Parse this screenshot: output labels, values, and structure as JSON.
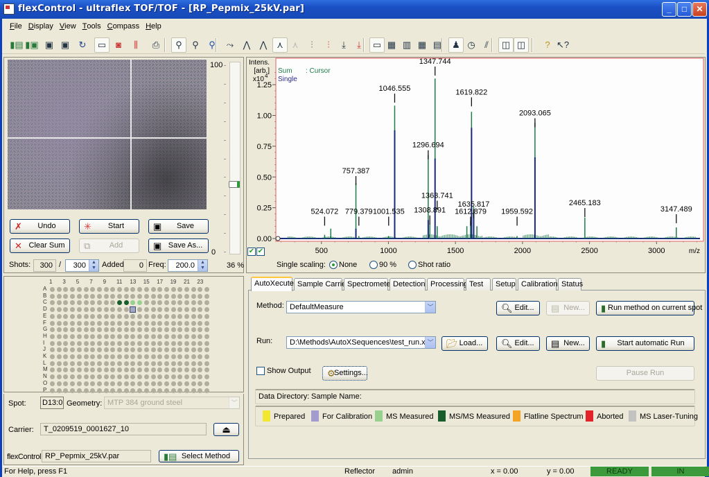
{
  "window": {
    "title": "flexControl - ultraflex TOF/TOF - [RP_Pepmix_25kV.par]",
    "controls": {
      "minimize": "_",
      "maximize": "□",
      "close": "✕"
    }
  },
  "menu": [
    {
      "label": "File",
      "ul": "F",
      "rest": "ile"
    },
    {
      "label": "Display",
      "ul": "D",
      "rest": "isplay"
    },
    {
      "label": "View",
      "ul": "V",
      "rest": "iew"
    },
    {
      "label": "Tools",
      "ul": "T",
      "rest": "ools"
    },
    {
      "label": "Compass",
      "ul": "C",
      "rest": "ompass"
    },
    {
      "label": "Help",
      "ul": "H",
      "rest": "elp"
    }
  ],
  "toolbar": {
    "icons": [
      {
        "name": "open-method-icon",
        "glyph": "▮▤"
      },
      {
        "name": "save-method-icon",
        "glyph": "▮▣"
      },
      {
        "name": "save-icon",
        "glyph": "▣"
      },
      {
        "name": "save-as-icon",
        "glyph": "▣"
      },
      {
        "name": "refresh-icon",
        "glyph": "↻"
      },
      {
        "name": "camera-icon",
        "glyph": "▭"
      },
      {
        "name": "camera-record-icon",
        "glyph": "◙"
      },
      {
        "name": "peak-icon",
        "glyph": "⫼"
      },
      {
        "name": "print-icon",
        "glyph": "⎙"
      },
      {
        "name": "zoom-icon",
        "glyph": "⚲"
      },
      {
        "name": "zoom-x-icon",
        "glyph": "⚲"
      },
      {
        "name": "zoom-reset-icon",
        "glyph": "⚲"
      },
      {
        "name": "peak-pick-icon",
        "glyph": "⤳"
      },
      {
        "name": "peak-add-icon",
        "glyph": "⋀"
      },
      {
        "name": "peak-remove-icon",
        "glyph": "⋀"
      },
      {
        "name": "spectrum-label-icon",
        "glyph": "⋏"
      },
      {
        "name": "spectrum-label-disabled-icon",
        "glyph": "⋏"
      },
      {
        "name": "sum-spectra-icon",
        "glyph": "⫶"
      },
      {
        "name": "sum-spectra-red-icon",
        "glyph": "⫶"
      },
      {
        "name": "peak-down-icon",
        "glyph": "⤓"
      },
      {
        "name": "peak-down-sum-icon",
        "glyph": "⤓"
      },
      {
        "name": "layout-1-icon",
        "glyph": "▭"
      },
      {
        "name": "layout-2-icon",
        "glyph": "▦"
      },
      {
        "name": "layout-3-icon",
        "glyph": "▥"
      },
      {
        "name": "layout-4-icon",
        "glyph": "▦"
      },
      {
        "name": "layout-5-icon",
        "glyph": "▤"
      },
      {
        "name": "user-icon",
        "glyph": "♟"
      },
      {
        "name": "clock-icon",
        "glyph": "◷"
      },
      {
        "name": "calibrate-icon",
        "glyph": "⫽"
      },
      {
        "name": "spectrum-view-icon",
        "glyph": "◫"
      },
      {
        "name": "events-view-icon",
        "glyph": "◫"
      },
      {
        "name": "help-icon",
        "glyph": "?"
      },
      {
        "name": "context-help-icon",
        "glyph": "↖?"
      }
    ]
  },
  "camera": {
    "slider": {
      "max_label": "100",
      "min_label": "0",
      "value_percent": 36,
      "value_label": "36 %"
    }
  },
  "acquisition": {
    "undo": "Undo",
    "start": "Start",
    "save": "Save",
    "clear_sum": "Clear Sum",
    "add": "Add",
    "save_as": "Save As...",
    "shots_label": "Shots:",
    "shots_value": "300",
    "shots_sep": "/",
    "shots_total": "300",
    "added_label": "Added:",
    "added_value": "0",
    "freq_label": "Freq:",
    "freq_value": "200.0"
  },
  "plate": {
    "columns_labeled": [
      "1",
      "3",
      "5",
      "7",
      "9",
      "11",
      "13",
      "15",
      "17",
      "19",
      "21",
      "23"
    ],
    "rows": [
      "A",
      "B",
      "C",
      "D",
      "E",
      "F",
      "G",
      "H",
      "I",
      "J",
      "K",
      "L",
      "M",
      "N",
      "O",
      "P"
    ],
    "num_columns": 24,
    "special_wells": [
      {
        "row": "C",
        "col": 11,
        "state": "MS/MS Measured"
      },
      {
        "row": "C",
        "col": 12,
        "state": "MS/MS Measured"
      },
      {
        "row": "C",
        "col": 13,
        "state": "MS Measured"
      },
      {
        "row": "C",
        "col": 14,
        "state": "MS Measured"
      },
      {
        "row": "D",
        "col": 13,
        "state": "current"
      }
    ]
  },
  "spot_info": {
    "spot_label": "Spot:",
    "spot_value": "D13:0",
    "geometry_label": "Geometry:",
    "geometry_value": "MTP 384 ground steel",
    "carrier_label": "Carrier:",
    "carrier_value": "T_0209519_0001627_10",
    "eject_glyph": "⏏",
    "flexcontrol_label": "flexControl:",
    "flexcontrol_value": "RP_Pepmix_25kV.par",
    "select_method": "Select Method"
  },
  "chart_data": {
    "type": "line",
    "title": "",
    "ylabel": "Intens. [arb.] x10^4",
    "ylabel_lines": [
      "Intens.",
      "[arb.]",
      "x10"
    ],
    "ylabel_exp": "4",
    "xlabel": "m/z",
    "legend": {
      "sum": "Sum",
      "cursor": ": Cursor",
      "single": "Single",
      "placement": "top-left"
    },
    "xlim": [
      160,
      3350
    ],
    "ylim": [
      0,
      1.42
    ],
    "xticks": [
      500,
      1000,
      1500,
      2000,
      2500,
      3000
    ],
    "xtick_labels": [
      "500",
      "1000",
      "1500",
      "2000",
      "2500",
      "3000"
    ],
    "yticks": [
      0.0,
      0.25,
      0.5,
      0.75,
      1.0,
      1.25
    ],
    "ytick_labels": [
      "0.00",
      "0.25",
      "0.50",
      "0.75",
      "1.00",
      "1.25"
    ],
    "series": [
      {
        "name": "Sum",
        "color": "#1e7b4a",
        "peaks": [
          {
            "mz": 524.072,
            "intensity": 0.03
          },
          {
            "mz": 570,
            "intensity": 0.08
          },
          {
            "mz": 757.387,
            "intensity": 0.45
          },
          {
            "mz": 779.379,
            "intensity": 0.02
          },
          {
            "mz": 1001.535,
            "intensity": 0.02
          },
          {
            "mz": 1046.555,
            "intensity": 1.08
          },
          {
            "mz": 1296.694,
            "intensity": 0.68
          },
          {
            "mz": 1308.891,
            "intensity": 0.12
          },
          {
            "mz": 1347.744,
            "intensity": 1.3
          },
          {
            "mz": 1363.741,
            "intensity": 0.1
          },
          {
            "mz": 1585,
            "intensity": 0.1
          },
          {
            "mz": 1612.879,
            "intensity": 0.14
          },
          {
            "mz": 1619.822,
            "intensity": 1.03
          },
          {
            "mz": 1635.817,
            "intensity": 0.26
          },
          {
            "mz": 1660,
            "intensity": 0.1
          },
          {
            "mz": 1959.592,
            "intensity": 0.02
          },
          {
            "mz": 2093.065,
            "intensity": 0.94
          },
          {
            "mz": 2465.183,
            "intensity": 0.17
          },
          {
            "mz": 3147.489,
            "intensity": 0.09
          }
        ]
      },
      {
        "name": "Single",
        "color": "#1a2a7a",
        "peaks": [
          {
            "mz": 757.387,
            "intensity": 0.08
          },
          {
            "mz": 1046.555,
            "intensity": 0.88
          },
          {
            "mz": 1296.694,
            "intensity": 0.15
          },
          {
            "mz": 1347.744,
            "intensity": 0.65
          },
          {
            "mz": 1619.822,
            "intensity": 0.9
          },
          {
            "mz": 1635.817,
            "intensity": 0.2
          },
          {
            "mz": 2093.065,
            "intensity": 0.66
          }
        ]
      }
    ],
    "peak_labels": [
      {
        "text": "524.072",
        "mz": 524.072,
        "y": 0.2
      },
      {
        "text": "757.387",
        "mz": 757.387,
        "y": 0.53
      },
      {
        "text": "779.379",
        "mz": 779.379,
        "y": 0.2
      },
      {
        "text": "1001.535",
        "mz": 1001.535,
        "y": 0.2
      },
      {
        "text": "1046.555",
        "mz": 1046.555,
        "y": 1.2
      },
      {
        "text": "1296.694",
        "mz": 1296.694,
        "y": 0.74
      },
      {
        "text": "1308.891",
        "mz": 1308.891,
        "y": 0.21
      },
      {
        "text": "1347.744",
        "mz": 1347.744,
        "y": 1.42
      },
      {
        "text": "1363.741",
        "mz": 1363.741,
        "y": 0.33
      },
      {
        "text": "1612.879",
        "mz": 1612.879,
        "y": 0.2
      },
      {
        "text": "1619.822",
        "mz": 1619.822,
        "y": 1.17
      },
      {
        "text": "1635.817",
        "mz": 1635.817,
        "y": 0.26
      },
      {
        "text": "1959.592",
        "mz": 1959.592,
        "y": 0.2
      },
      {
        "text": "2093.065",
        "mz": 2093.065,
        "y": 1.0
      },
      {
        "text": "2465.183",
        "mz": 2465.183,
        "y": 0.27
      },
      {
        "text": "3147.489",
        "mz": 3147.489,
        "y": 0.22
      }
    ]
  },
  "spectrum_controls": {
    "single_scaling_label": "Single scaling:",
    "options": [
      "None",
      "90 %",
      "Shot ratio"
    ],
    "selected": "None",
    "check1": "✔",
    "check2": "✔"
  },
  "tabs": [
    "AutoXecute",
    "Sample Carrier",
    "Spectrometer",
    "Detection",
    "Processing",
    "Test",
    "Setup",
    "Calibration",
    "Status"
  ],
  "active_tab": "AutoXecute",
  "autoxecute": {
    "method_label": "Method:",
    "method_value": "DefaultMeasure",
    "edit1": "Edit...",
    "new1": "New...",
    "run_method": "Run method on current spot",
    "run_label": "Run:",
    "run_value": "D:\\Methods\\AutoXSequences\\test_run.xml",
    "load": "Load...",
    "edit2": "Edit...",
    "new2": "New...",
    "start_run": "Start automatic Run",
    "show_output": "Show Output",
    "settings": "Settings...",
    "pause_run": "Pause Run",
    "data_directory_label": "Data Directory:",
    "sample_name_label": "Sample Name:"
  },
  "legend": [
    {
      "label": "Prepared",
      "color": "#f2e832"
    },
    {
      "label": "For Calibration",
      "color": "#a49ccf"
    },
    {
      "label": "MS Measured",
      "color": "#98d08f"
    },
    {
      "label": "MS/MS Measured",
      "color": "#175e2c"
    },
    {
      "label": "Flatline Spectrum",
      "color": "#f5a325"
    },
    {
      "label": "Aborted",
      "color": "#e3222a"
    },
    {
      "label": "MS Laser-Tuning",
      "color": "#c2c2c0"
    }
  ],
  "statusbar": {
    "help": "For Help, press F1",
    "mode": "Reflector",
    "user": "admin",
    "x": "x = 0.00",
    "y": "y = 0.00",
    "ready": "READY",
    "in": "IN"
  }
}
